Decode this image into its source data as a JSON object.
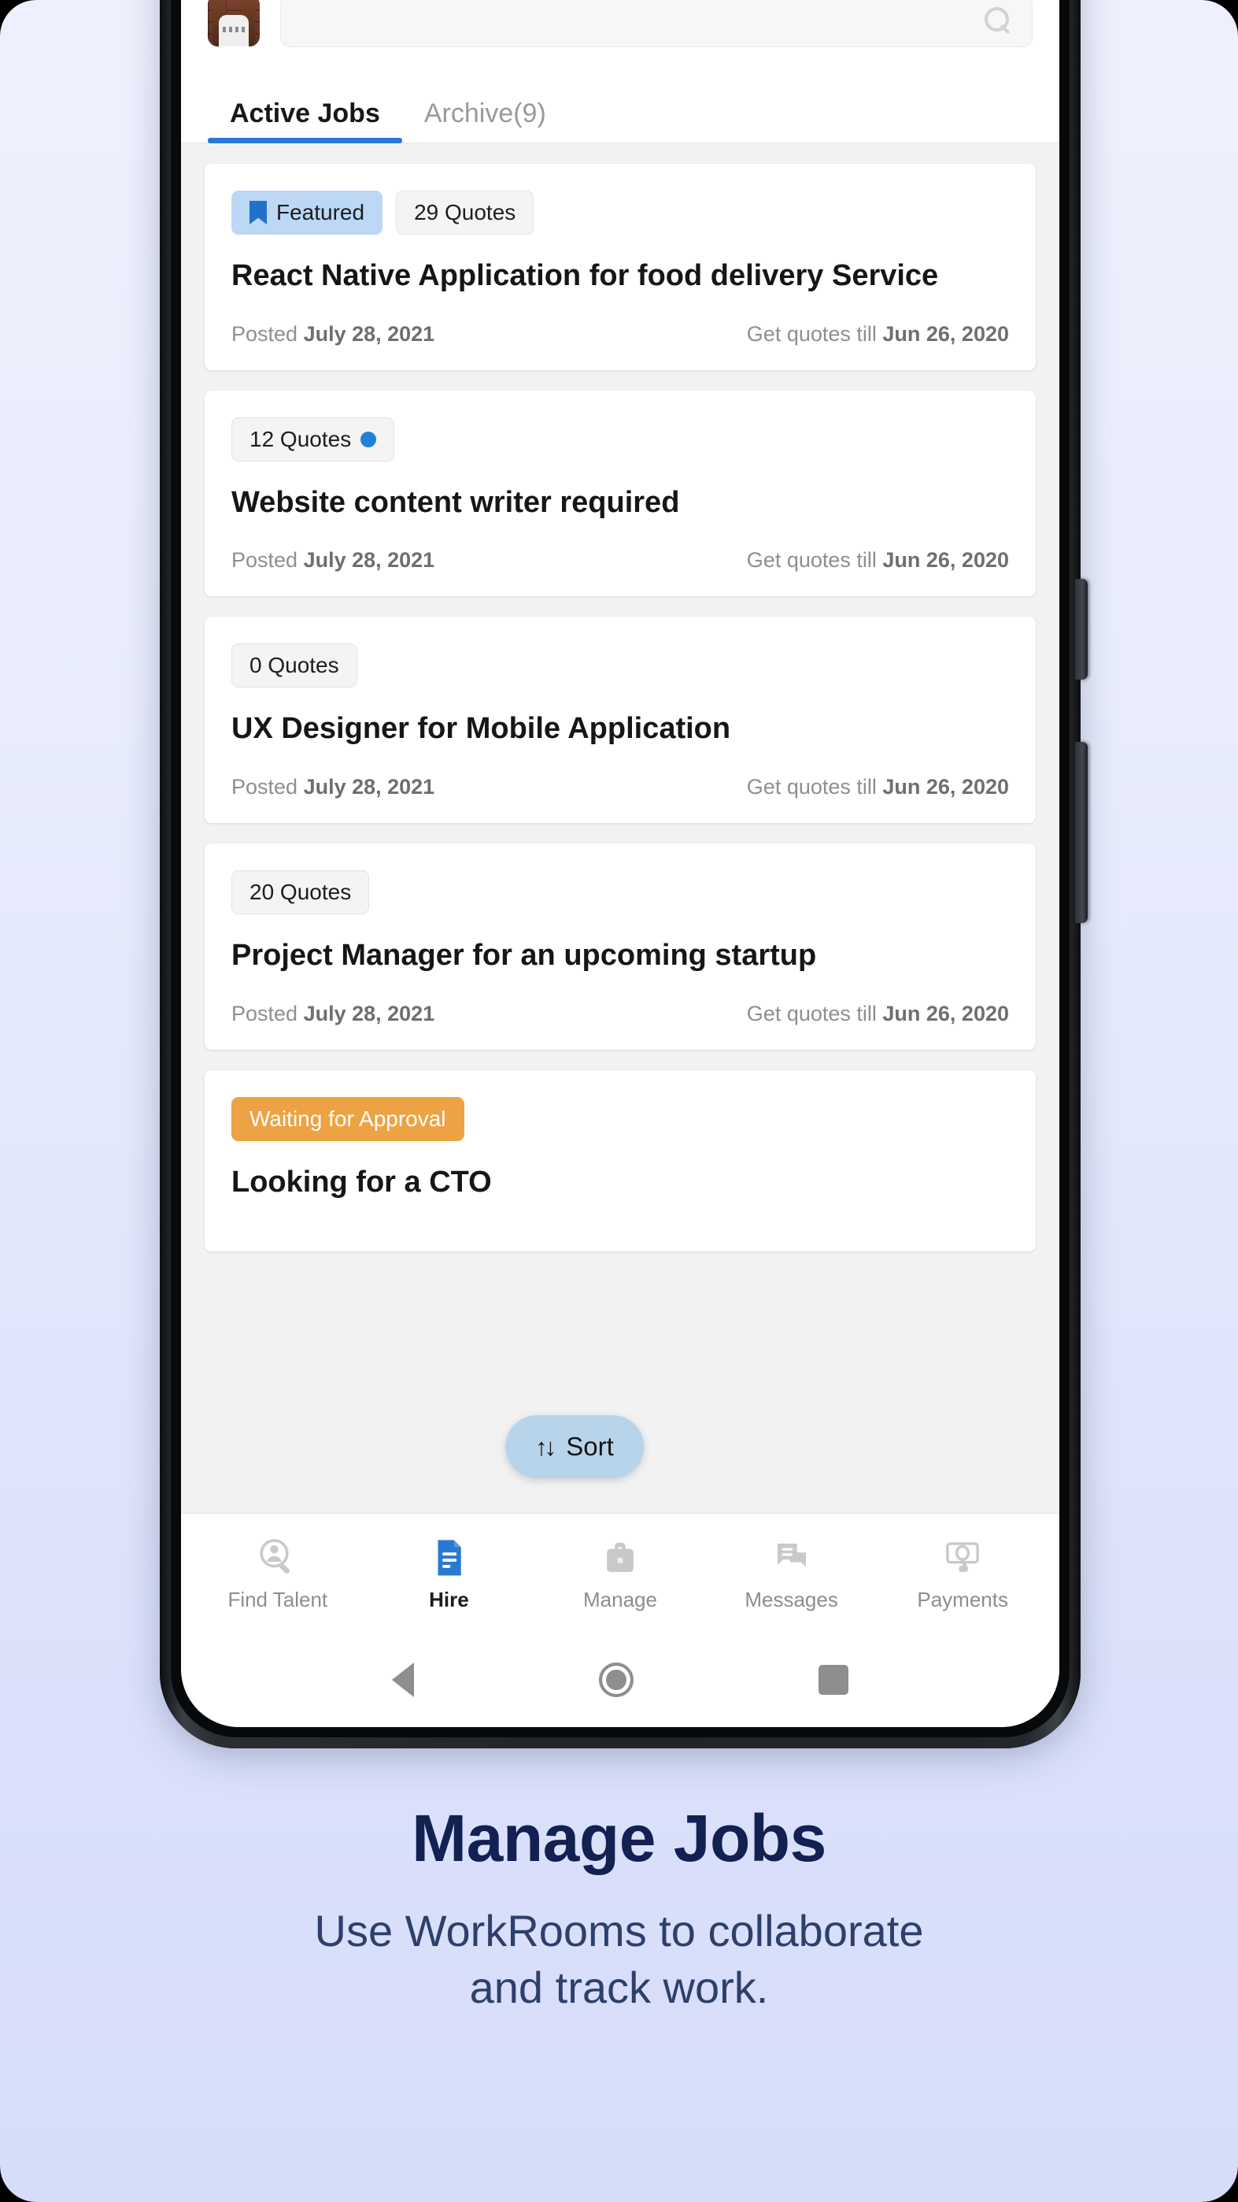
{
  "search": {
    "placeholder": "",
    "value": "",
    "icon": "search-icon"
  },
  "avatar": {
    "name": "user-avatar"
  },
  "tabs": [
    {
      "label": "Active Jobs",
      "active": true
    },
    {
      "label": "Archive(9)",
      "active": false
    }
  ],
  "jobs": [
    {
      "featured_label": "Featured",
      "featured": true,
      "quotes_label": "29 Quotes",
      "has_dot": false,
      "status_label": "",
      "title": "React Native Application for food delivery Service",
      "posted_prefix": "Posted ",
      "posted_date": "July 28, 2021",
      "till_prefix": "Get quotes till ",
      "till_date": "Jun 26, 2020"
    },
    {
      "featured_label": "",
      "featured": false,
      "quotes_label": "12 Quotes",
      "has_dot": true,
      "status_label": "",
      "title": "Website content writer required",
      "posted_prefix": "Posted ",
      "posted_date": "July 28, 2021",
      "till_prefix": "Get quotes till ",
      "till_date": "Jun 26, 2020"
    },
    {
      "featured_label": "",
      "featured": false,
      "quotes_label": "0 Quotes",
      "has_dot": false,
      "status_label": "",
      "title": "UX Designer for Mobile Application",
      "posted_prefix": "Posted ",
      "posted_date": "July 28, 2021",
      "till_prefix": "Get quotes till ",
      "till_date": "Jun 26, 2020"
    },
    {
      "featured_label": "",
      "featured": false,
      "quotes_label": "20 Quotes",
      "has_dot": false,
      "status_label": "",
      "title": "Project Manager for an upcoming startup",
      "posted_prefix": "Posted ",
      "posted_date": "July 28, 2021",
      "till_prefix": "Get quotes till ",
      "till_date": "Jun 26, 2020"
    },
    {
      "featured_label": "",
      "featured": false,
      "quotes_label": "",
      "has_dot": false,
      "status_label": "Waiting for Approval",
      "title": "Looking for a CTO",
      "posted_prefix": "",
      "posted_date": "",
      "till_prefix": "",
      "till_date": ""
    }
  ],
  "sort": {
    "label": "Sort",
    "arrows": "↑↓",
    "icon": "sort-icon"
  },
  "bottom_nav": [
    {
      "label": "Find Talent",
      "icon": "find-talent-icon",
      "active": false
    },
    {
      "label": "Hire",
      "icon": "hire-document-icon",
      "active": true
    },
    {
      "label": "Manage",
      "icon": "briefcase-icon",
      "active": false
    },
    {
      "label": "Messages",
      "icon": "chat-bubbles-icon",
      "active": false
    },
    {
      "label": "Payments",
      "icon": "money-hand-icon",
      "active": false
    }
  ],
  "system_nav": [
    {
      "name": "back-button",
      "icon": "triangle-back-icon"
    },
    {
      "name": "home-button",
      "icon": "circle-home-icon"
    },
    {
      "name": "recents-button",
      "icon": "square-recents-icon"
    }
  ],
  "caption": {
    "title": "Manage Jobs",
    "subtitle_line1": "Use WorkRooms to collaborate",
    "subtitle_line2": "and track work."
  },
  "colors": {
    "accent_blue": "#2979d2",
    "featured_bg": "#bcd8f5",
    "featured_icon": "#2271c9",
    "dot_blue": "#2680d8",
    "status_orange": "#eda243",
    "sort_bg": "#b8d4ea",
    "caption_title": "#122052",
    "caption_sub": "#2d3f6b",
    "list_bg": "#f2f2f2"
  }
}
